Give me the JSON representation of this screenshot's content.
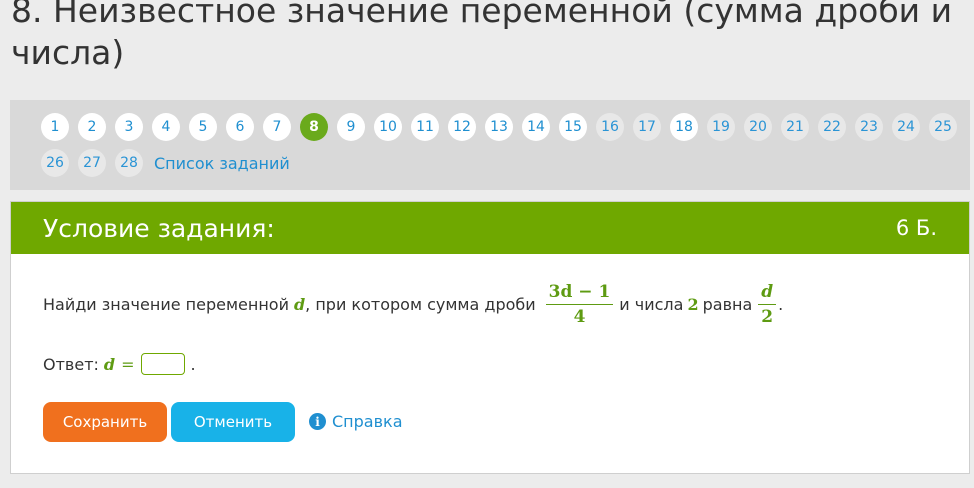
{
  "page_title": "8. Неизвестное значение переменной (сумма дроби и числа)",
  "nav": {
    "pages": [
      {
        "label": "1",
        "state": "normal"
      },
      {
        "label": "2",
        "state": "normal"
      },
      {
        "label": "3",
        "state": "normal"
      },
      {
        "label": "4",
        "state": "normal"
      },
      {
        "label": "5",
        "state": "normal"
      },
      {
        "label": "6",
        "state": "normal"
      },
      {
        "label": "7",
        "state": "normal"
      },
      {
        "label": "8",
        "state": "current"
      },
      {
        "label": "9",
        "state": "normal"
      },
      {
        "label": "10",
        "state": "normal"
      },
      {
        "label": "11",
        "state": "normal"
      },
      {
        "label": "12",
        "state": "normal"
      },
      {
        "label": "13",
        "state": "normal"
      },
      {
        "label": "14",
        "state": "normal"
      },
      {
        "label": "15",
        "state": "normal"
      },
      {
        "label": "16",
        "state": "done"
      },
      {
        "label": "17",
        "state": "done"
      },
      {
        "label": "18",
        "state": "normal"
      },
      {
        "label": "19",
        "state": "done"
      },
      {
        "label": "20",
        "state": "done"
      },
      {
        "label": "21",
        "state": "done"
      },
      {
        "label": "22",
        "state": "done"
      },
      {
        "label": "23",
        "state": "done"
      },
      {
        "label": "24",
        "state": "done"
      },
      {
        "label": "25",
        "state": "done"
      },
      {
        "label": "26",
        "state": "done"
      },
      {
        "label": "27",
        "state": "done"
      },
      {
        "label": "28",
        "state": "done"
      }
    ],
    "tasks_link": "Список заданий"
  },
  "task": {
    "header_title": "Условие задания:",
    "points": "6 Б.",
    "question": {
      "part1": "Найди значение переменной",
      "var": "d",
      "part2": ", при котором сумма дроби",
      "frac1_num": "3d − 1",
      "frac1_den": "4",
      "part3": "и числа",
      "number": "2",
      "part4": "равна",
      "frac2_num": "d",
      "frac2_den": "2",
      "end": "."
    },
    "answer": {
      "label": "Ответ:",
      "var": "d",
      "eq": "=",
      "value": "",
      "end": "."
    },
    "buttons": {
      "save": "Сохранить",
      "cancel": "Отменить",
      "help": "Справка"
    }
  },
  "colors": {
    "header_green": "#6fa800",
    "current_page": "#6aaa1c",
    "save": "#f0701e",
    "cancel": "#18b2e8",
    "link": "#1f8fd0"
  }
}
